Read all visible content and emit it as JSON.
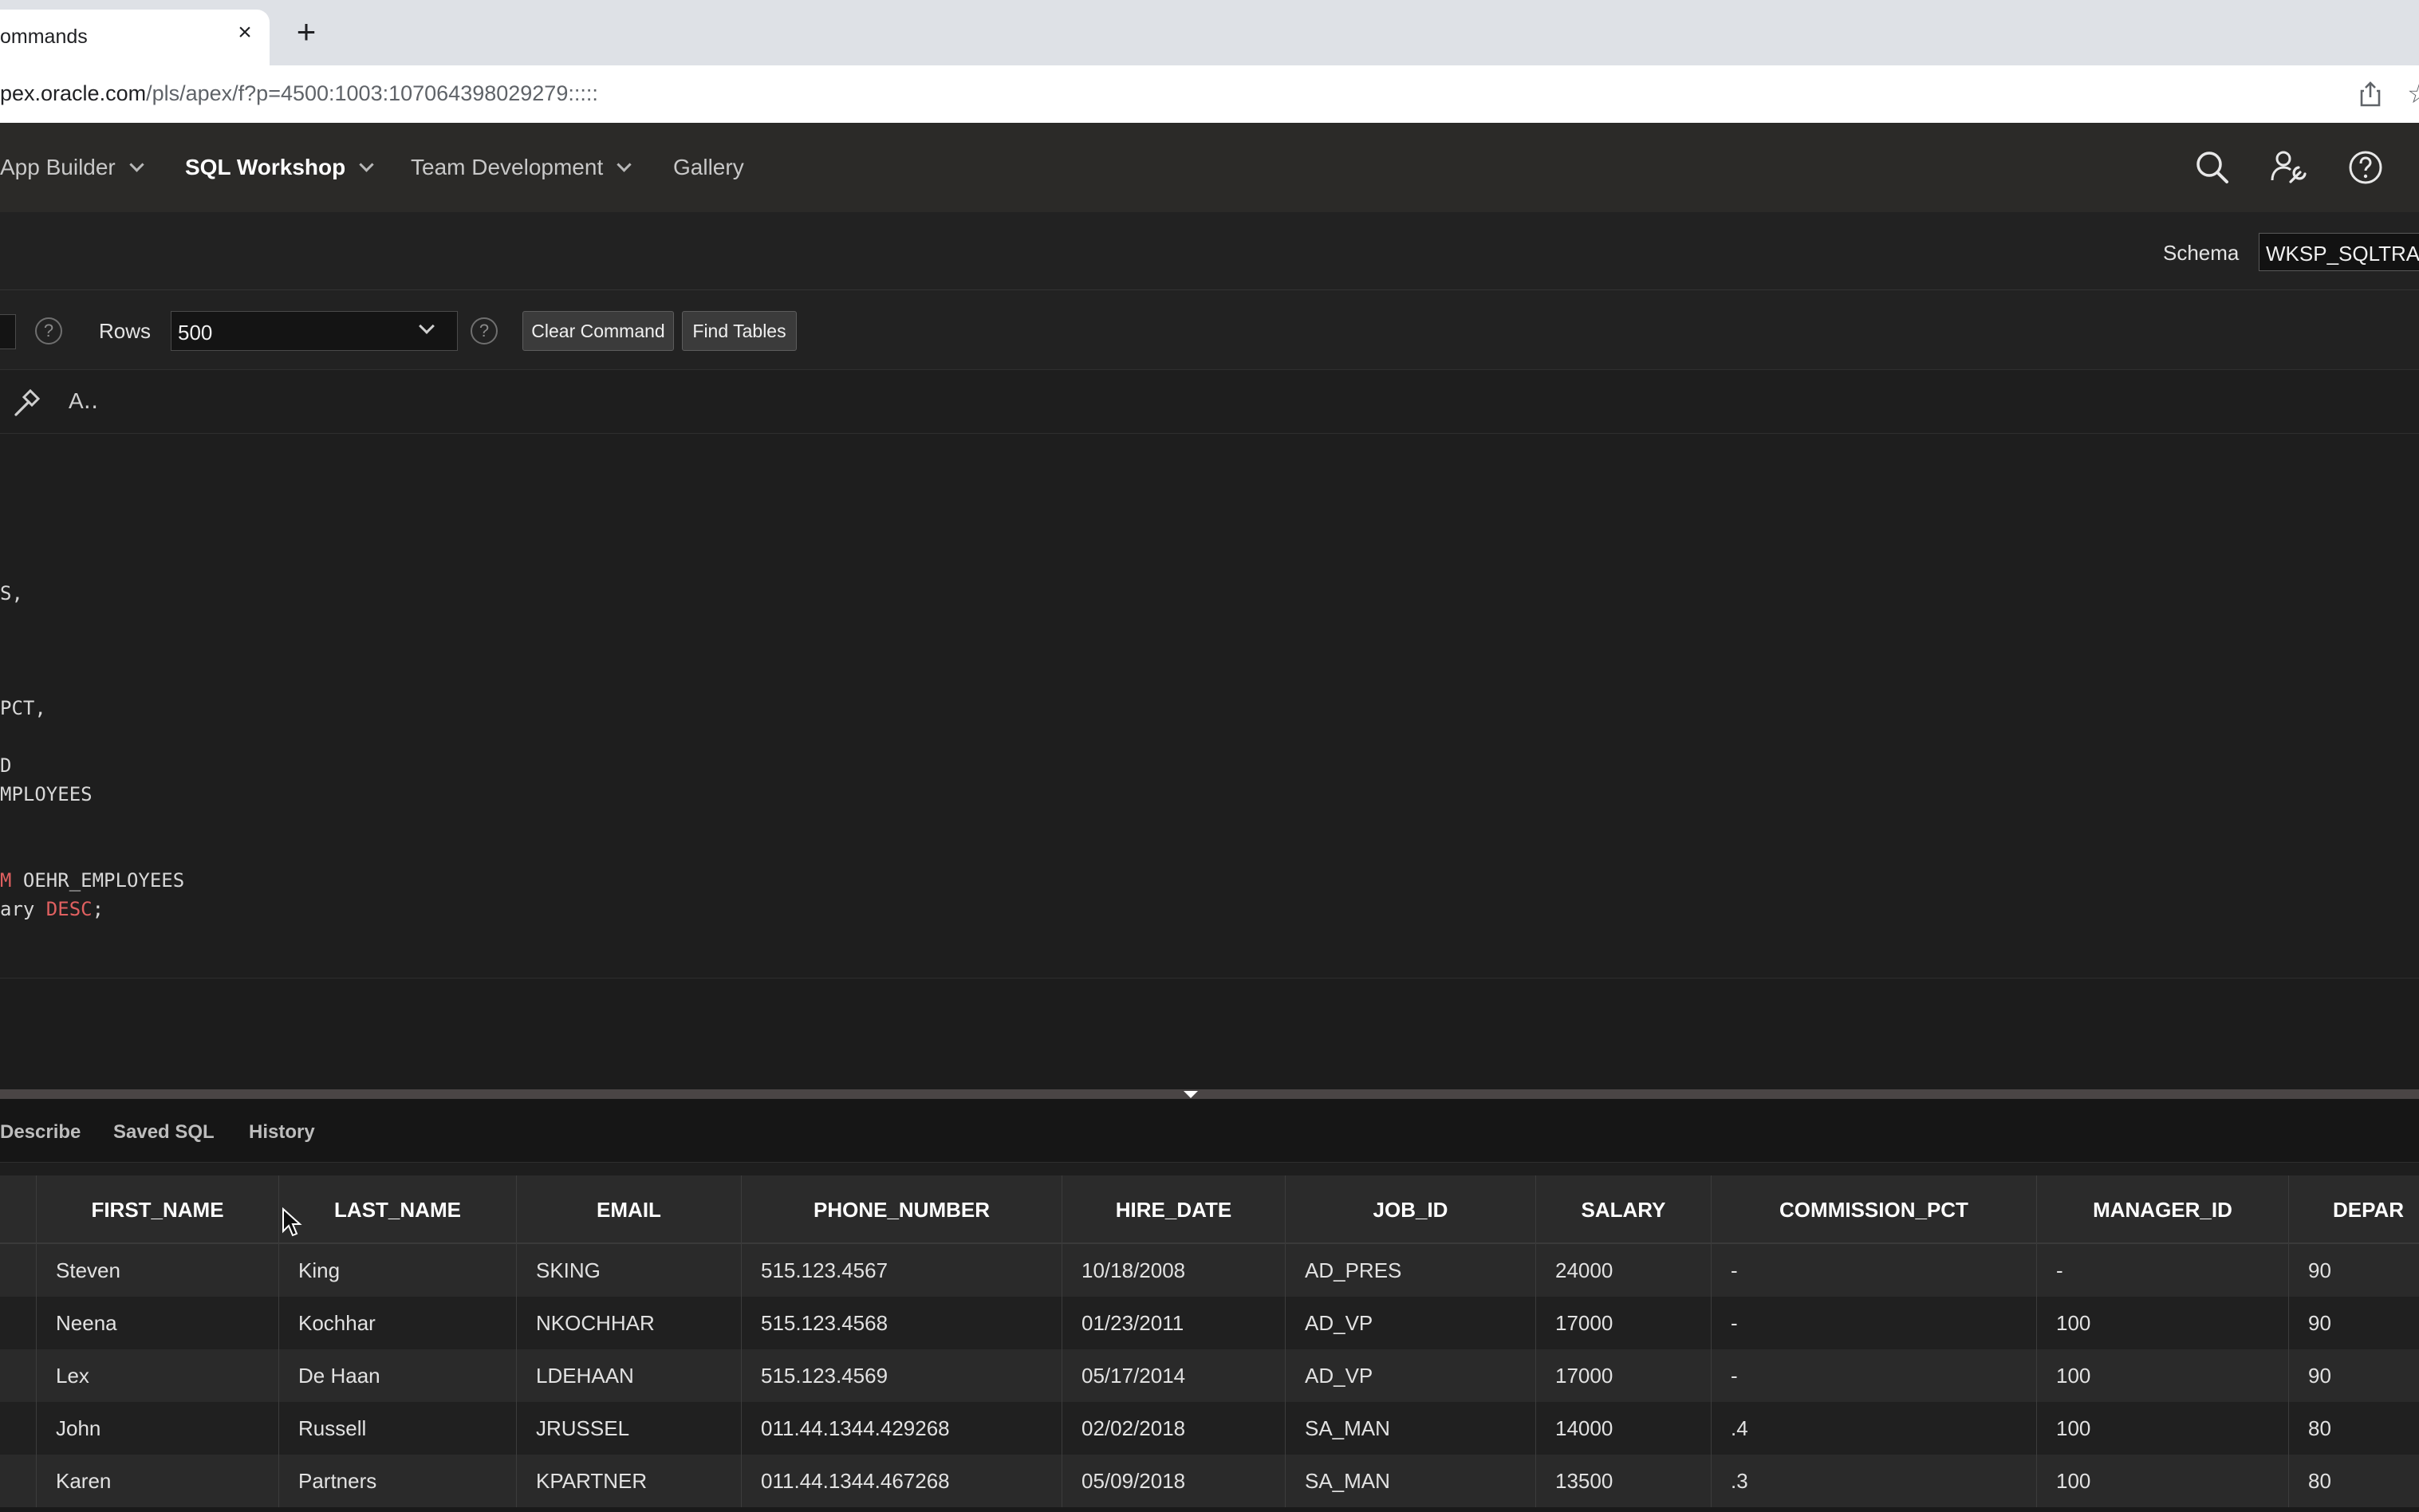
{
  "browser": {
    "tab_title": "ommands",
    "tab_close": "×",
    "new_tab": "+",
    "url_host": "pex.oracle.com",
    "url_path": "/pls/apex/f?p=4500:1003:107064398029279:::::"
  },
  "nav": {
    "items": [
      {
        "label": "App Builder",
        "has_menu": true
      },
      {
        "label": "SQL Workshop",
        "has_menu": true,
        "active": true
      },
      {
        "label": "Team Development",
        "has_menu": true
      },
      {
        "label": "Gallery",
        "has_menu": false
      }
    ],
    "icons": [
      "search-icon",
      "admin-wrench-icon",
      "help-icon"
    ]
  },
  "schema": {
    "label": "Schema",
    "value": "WKSP_SQLTRAINI"
  },
  "toolbar": {
    "rows_label": "Rows",
    "rows_value": "500",
    "help_glyph": "?",
    "clear_command": "Clear Command",
    "find_tables": "Find Tables"
  },
  "editor": {
    "font_toggle": "A‥",
    "lines": [
      {
        "text": "S,"
      },
      {
        "text": "PCT,"
      },
      {
        "text": "D"
      },
      {
        "text": "MPLOYEES"
      },
      {
        "pre": "",
        "kw": "M",
        "post": " OEHR_EMPLOYEES"
      },
      {
        "pre": "ary ",
        "kw": "DESC",
        "post": ";"
      }
    ]
  },
  "result_tabs": [
    "Describe",
    "Saved SQL",
    "History"
  ],
  "results": {
    "columns": [
      "FIRST_NAME",
      "LAST_NAME",
      "EMAIL",
      "PHONE_NUMBER",
      "HIRE_DATE",
      "JOB_ID",
      "SALARY",
      "COMMISSION_PCT",
      "MANAGER_ID",
      "DEPAR"
    ],
    "rows": [
      [
        "Steven",
        "King",
        "SKING",
        "515.123.4567",
        "10/18/2008",
        "AD_PRES",
        "24000",
        "-",
        "-",
        "90"
      ],
      [
        "Neena",
        "Kochhar",
        "NKOCHHAR",
        "515.123.4568",
        "01/23/2011",
        "AD_VP",
        "17000",
        "-",
        "100",
        "90"
      ],
      [
        "Lex",
        "De Haan",
        "LDEHAAN",
        "515.123.4569",
        "05/17/2014",
        "AD_VP",
        "17000",
        "-",
        "100",
        "90"
      ],
      [
        "John",
        "Russell",
        "JRUSSEL",
        "011.44.1344.429268",
        "02/02/2018",
        "SA_MAN",
        "14000",
        ".4",
        "100",
        "80"
      ],
      [
        "Karen",
        "Partners",
        "KPARTNER",
        "011.44.1344.467268",
        "05/09/2018",
        "SA_MAN",
        "13500",
        ".3",
        "100",
        "80"
      ]
    ]
  }
}
